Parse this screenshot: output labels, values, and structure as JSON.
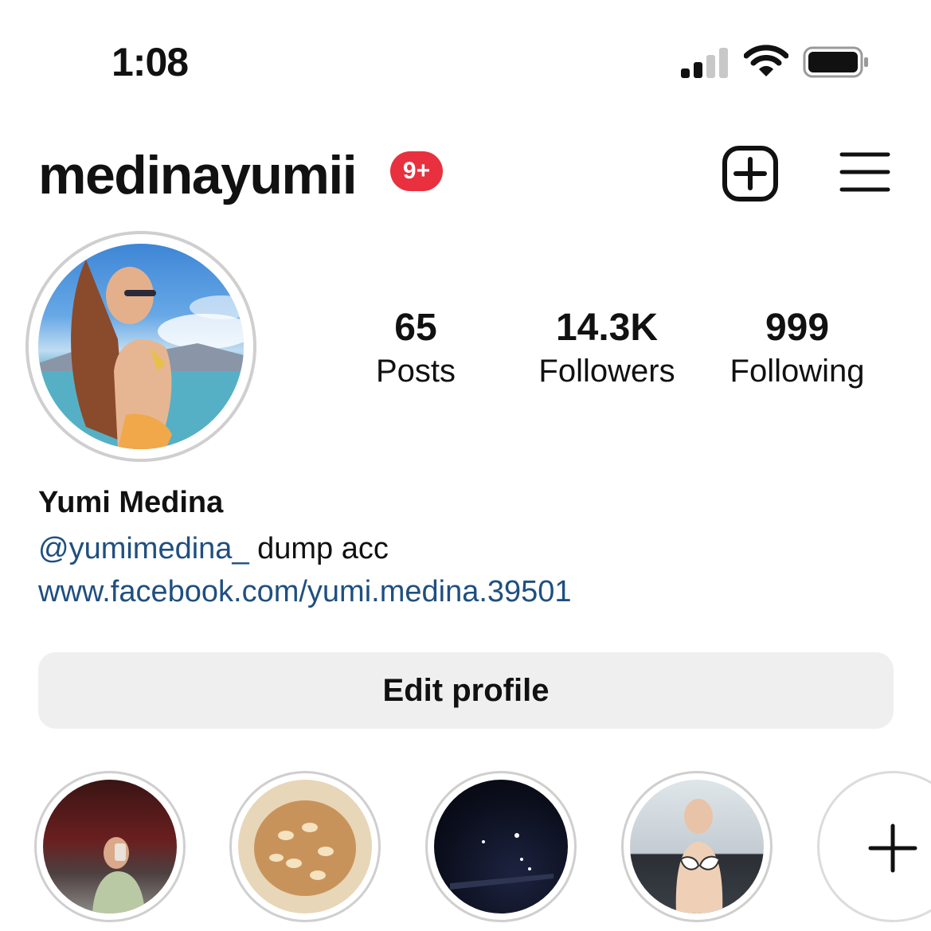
{
  "status_bar": {
    "time": "1:08",
    "icons": [
      "cellular-signal-icon",
      "wifi-icon",
      "battery-icon"
    ]
  },
  "header": {
    "username": "medinayumii",
    "notification_badge": "9+",
    "badge_color": "#e8303f",
    "actions": [
      "add-post-icon",
      "menu-icon"
    ]
  },
  "stats": [
    {
      "value": "65",
      "label": "Posts"
    },
    {
      "value": "14.3K",
      "label": "Followers"
    },
    {
      "value": "999",
      "label": "Following"
    }
  ],
  "bio": {
    "name": "Yumi Medina",
    "mention": "@yumimedina_",
    "text": " dump acc",
    "link": "www.facebook.com/yumi.medina.39501",
    "link_color": "#1f4f80"
  },
  "edit_profile_label": "Edit profile",
  "highlights": [
    {
      "icon": "highlight-photo-mirror-selfie"
    },
    {
      "icon": "highlight-photo-baked-goods"
    },
    {
      "icon": "highlight-photo-night-street"
    },
    {
      "icon": "highlight-photo-selfie"
    },
    {
      "icon": "plus-icon"
    }
  ]
}
